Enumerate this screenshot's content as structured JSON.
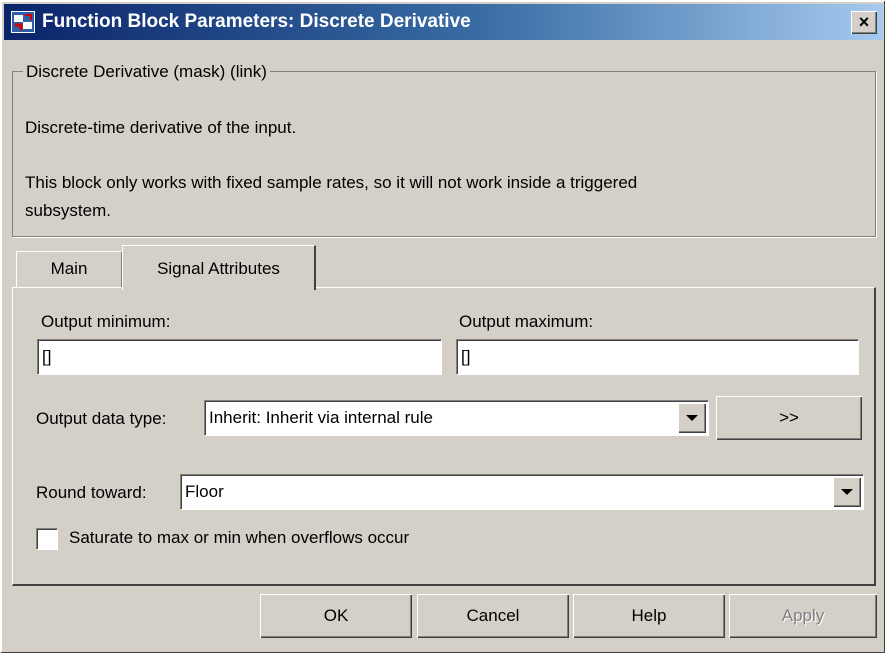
{
  "window": {
    "title": "Function Block Parameters: Discrete Derivative",
    "close_label": "×"
  },
  "description": {
    "group_title": "Discrete Derivative (mask) (link)",
    "line1": "Discrete-time derivative of the input.",
    "line2": "This block only works with fixed sample rates, so it will not work inside a triggered",
    "line3": "subsystem."
  },
  "tabs": [
    {
      "label": "Main",
      "selected": false
    },
    {
      "label": "Signal Attributes",
      "selected": true
    }
  ],
  "signal_attributes": {
    "output_minimum_label": "Output minimum:",
    "output_minimum_value": "[]",
    "output_maximum_label": "Output maximum:",
    "output_maximum_value": "[]",
    "output_data_type_label": "Output data type:",
    "output_data_type_value": "Inherit: Inherit via internal rule",
    "data_type_assistant_label": ">>",
    "round_toward_label": "Round toward:",
    "round_toward_value": "Floor",
    "saturate_label": "Saturate to max or min when overflows occur",
    "saturate_checked": false
  },
  "buttons": {
    "ok": "OK",
    "cancel": "Cancel",
    "help": "Help",
    "apply": "Apply"
  },
  "colors": {
    "dialog_bg": "#d4d0c8",
    "title_bar_start": "#0a246a",
    "title_bar_end": "#a6caf0"
  }
}
